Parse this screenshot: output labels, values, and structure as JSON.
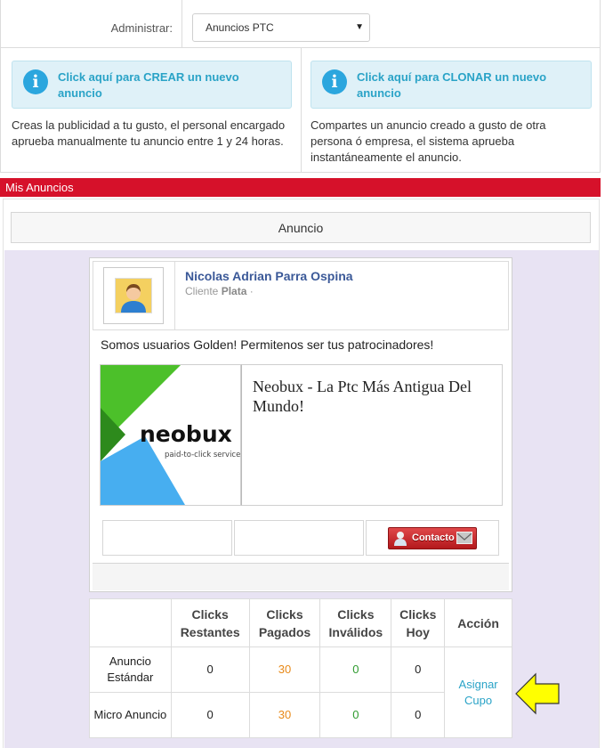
{
  "admin": {
    "label": "Administrar:",
    "selected": "Anuncios PTC"
  },
  "create_panel": {
    "info_text": "Click aquí para CREAR un nuevo anuncio",
    "description": "Creas la publicidad a tu gusto, el personal encargado aprueba manualmente tu anuncio entre 1 y 24 horas."
  },
  "clone_panel": {
    "info_text": "Click aquí para CLONAR un nuevo anuncio",
    "description": "Compartes un anuncio creado a gusto de otra persona ó empresa, el sistema aprueba instantáneamente el anuncio."
  },
  "section_title": "Mis Anuncios",
  "anuncio_header": "Anuncio",
  "ad": {
    "author_name": "Nicolas Adrian Parra Ospina",
    "client_prefix": "Cliente",
    "client_level": "Plata",
    "slogan": "Somos usuarios Golden! Permitenos ser tus patrocinadores!",
    "logo_word": "neobux",
    "logo_tagline": "paid-to-click service",
    "title": "Neobux - La Ptc Más Antigua Del Mundo!",
    "contact_label": "Contacto"
  },
  "stats": {
    "headers": [
      "",
      "Clicks Restantes",
      "Clicks Pagados",
      "Clicks Inválidos",
      "Clicks Hoy",
      "Acción"
    ],
    "rows": [
      {
        "type": "Anuncio Estándar",
        "restantes": "0",
        "pagados": "30",
        "invalidos": "0",
        "hoy": "0"
      },
      {
        "type": "Micro Anuncio",
        "restantes": "0",
        "pagados": "30",
        "invalidos": "0",
        "hoy": "0"
      }
    ],
    "action_label": "Asignar Cupo"
  },
  "colors": {
    "red_bar": "#d6112a",
    "info_blue": "#2aa3c7",
    "name_blue": "#3b5998",
    "orange": "#e88a1a",
    "green": "#2e9b2e",
    "arrow_yellow": "#ffff00"
  }
}
